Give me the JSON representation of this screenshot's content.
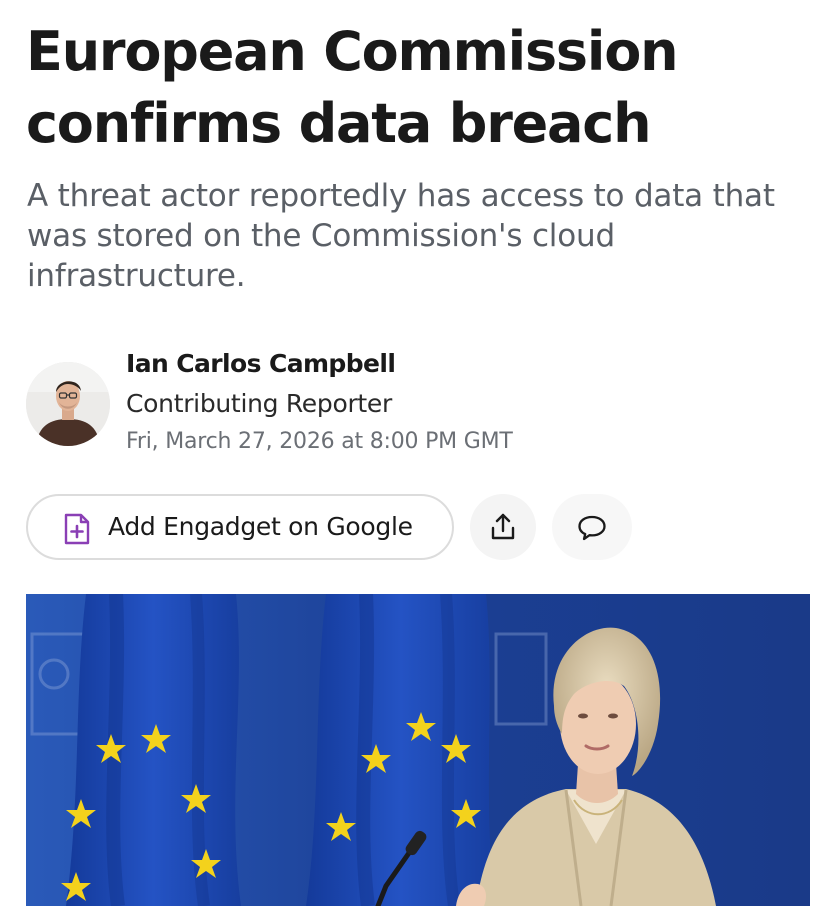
{
  "article": {
    "headline": "European Commission confirms data breach",
    "subheadline": "A threat actor reportedly has access to data that was stored on the Commission's cloud infrastructure."
  },
  "author": {
    "name": "Ian Carlos Campbell",
    "role": "Contributing Reporter",
    "date": "Fri, March 27, 2026 at 8:00 PM GMT",
    "avatar_icon": "author-photo"
  },
  "actions": {
    "google_button_label": "Add Engadget on Google",
    "google_button_icon": "add-source-doc-icon",
    "share_icon": "share-icon",
    "comment_icon": "comment-icon"
  },
  "hero": {
    "image_subject": "eu-flags-and-speaker-photo"
  },
  "colors": {
    "accent_purple": "#8a3fb5",
    "flag_blue": "#1c44a8",
    "star_yellow": "#f3d21c",
    "subhead_gray": "#5a5f66"
  }
}
